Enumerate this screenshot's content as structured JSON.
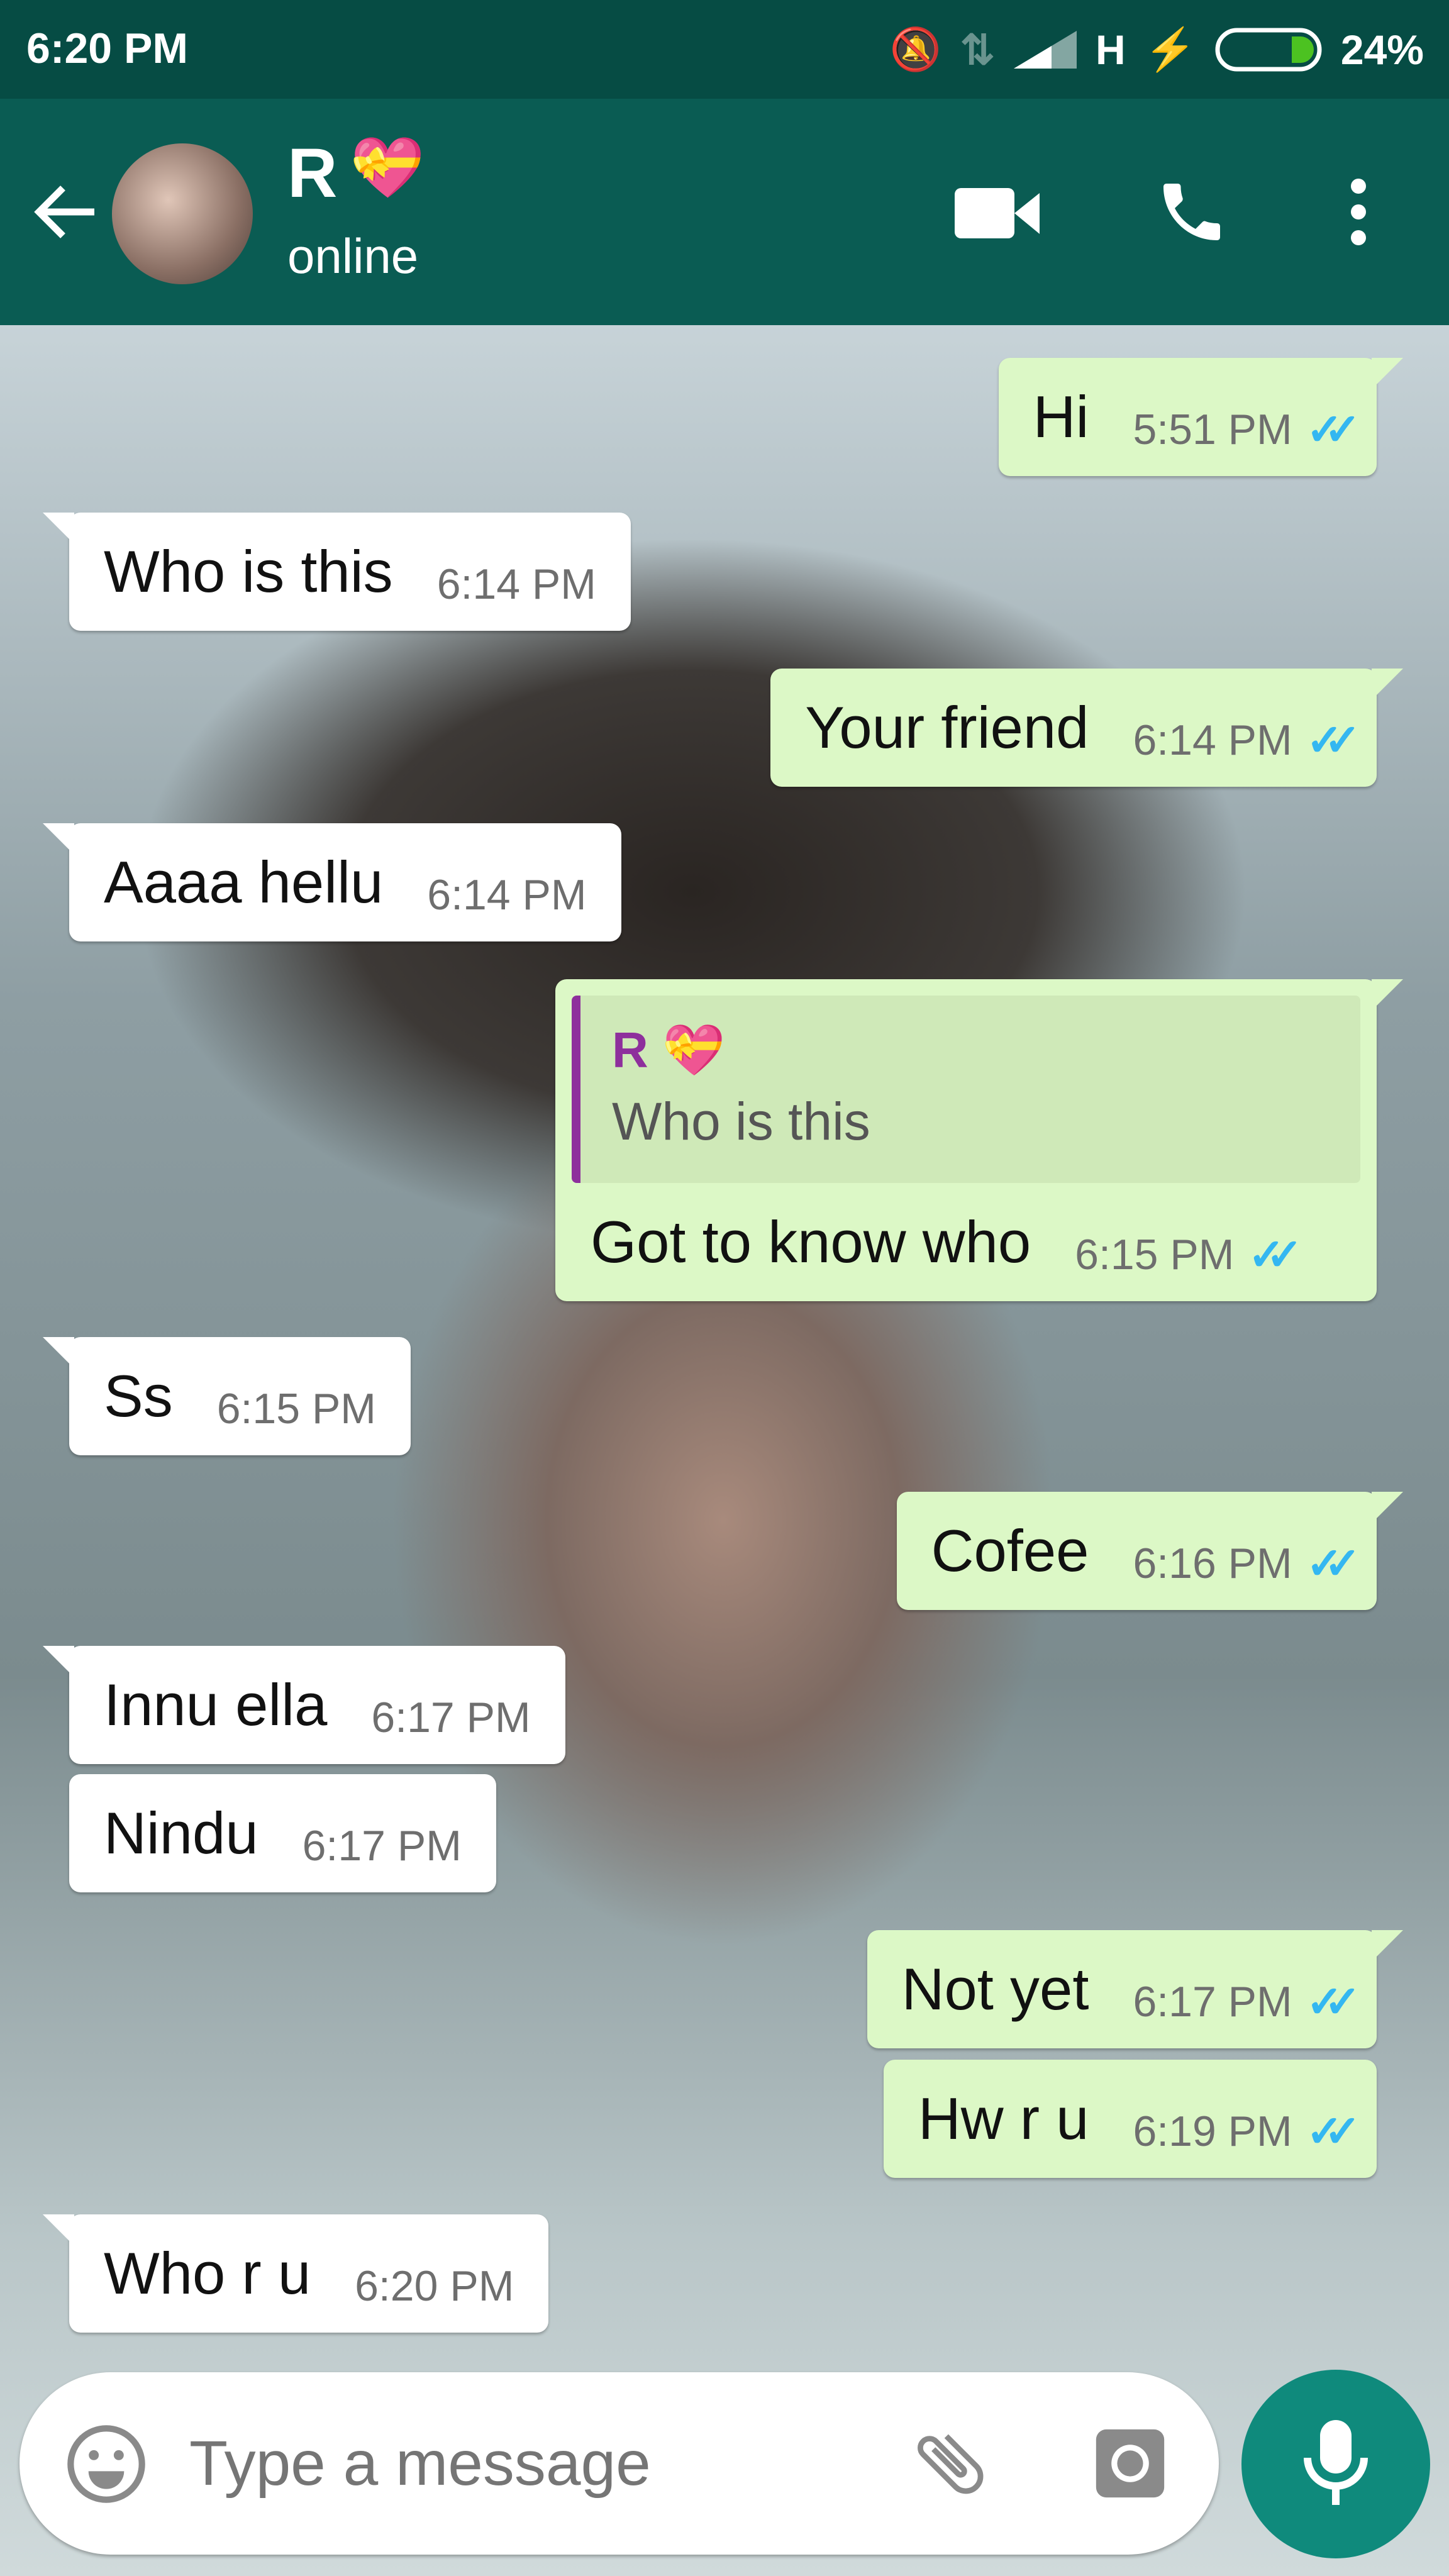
{
  "status_bar": {
    "time": "6:20 PM",
    "network": "H",
    "battery": "24%",
    "battery_level": 0.24
  },
  "header": {
    "contact_name": "R",
    "contact_emoji": "💝",
    "presence": "online"
  },
  "messages": [
    {
      "dir": "out",
      "text": "Hi",
      "time": "5:51 PM"
    },
    {
      "dir": "in",
      "text": "Who is this",
      "time": "6:14 PM"
    },
    {
      "dir": "out",
      "text": "Your friend",
      "time": "6:14 PM"
    },
    {
      "dir": "in",
      "text": "Aaaa hellu",
      "time": "6:14 PM"
    },
    {
      "dir": "out",
      "text": "Got to know who",
      "time": "6:15 PM",
      "quote": {
        "name": "R",
        "emoji": "💝",
        "text": "Who is this"
      }
    },
    {
      "dir": "in",
      "text": "Ss",
      "time": "6:15 PM"
    },
    {
      "dir": "out",
      "text": "Cofee",
      "time": "6:16 PM"
    },
    {
      "dir": "in",
      "text": "Innu ella",
      "time": "6:17 PM"
    },
    {
      "dir": "in",
      "text": "Nindu",
      "time": "6:17 PM"
    },
    {
      "dir": "out",
      "text": "Not yet",
      "time": "6:17 PM"
    },
    {
      "dir": "out",
      "text": "Hw r u",
      "time": "6:19 PM"
    },
    {
      "dir": "in",
      "text": "Who r u",
      "time": "6:20 PM"
    }
  ],
  "composer": {
    "placeholder": "Type a message"
  },
  "colors": {
    "header": "#0a5c53",
    "outgoing": "#dcf8c6",
    "incoming": "#ffffff",
    "tick": "#34b7f1",
    "mic": "#0f8a7c"
  }
}
